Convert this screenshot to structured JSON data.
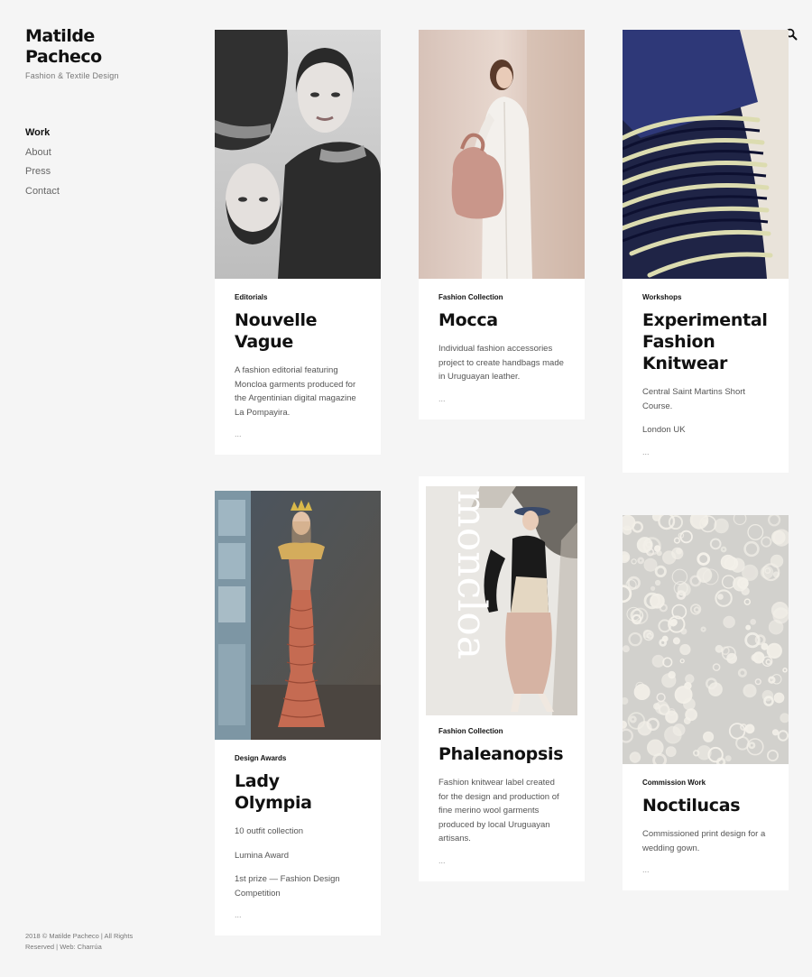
{
  "brand": {
    "name": "Matilde Pacheco",
    "subtitle": "Fashion & Textile Design"
  },
  "nav": {
    "items": [
      {
        "label": "Work",
        "active": true
      },
      {
        "label": "About",
        "active": false
      },
      {
        "label": "Press",
        "active": false
      },
      {
        "label": "Contact",
        "active": false
      }
    ]
  },
  "footer": {
    "text": "2018 © Matilde Pacheco | All Rights Reserved | Web: Charrúa"
  },
  "projects": [
    {
      "category": "Editorials",
      "title": "Nouvelle Vague",
      "paragraphs": [
        "A fashion editorial featuring Moncloa garments produced for the Argentinian digital magazine La Pompayira."
      ],
      "more": "...",
      "image": "editorial-portrait-image"
    },
    {
      "category": "Fashion Collection",
      "title": "Mocca",
      "paragraphs": [
        "Individual fashion accessories project to create handbags made in Uruguayan leather."
      ],
      "more": "...",
      "image": "model-handbag-image"
    },
    {
      "category": "Workshops",
      "title": "Experimental Fashion Knitwear",
      "paragraphs": [
        "Central Saint Martins Short Course.",
        "London UK"
      ],
      "more": "...",
      "image": "knitwear-closeup-image"
    },
    {
      "category": "Design Awards",
      "title": "Lady Olympia",
      "paragraphs": [
        "10 outfit collection",
        "Lumina Award",
        "1st prize — Fashion Design Competition"
      ],
      "more": "...",
      "image": "gown-model-image"
    },
    {
      "category": "Fashion Collection",
      "title": "Phaleanopsis",
      "paragraphs": [
        "Fashion knitwear label created for the design and production of fine merino wool garments produced by local Uruguayan artisans."
      ],
      "more": "...",
      "image": "moncloa-campaign-image",
      "image_text": "moncloa"
    },
    {
      "category": "Commission Work",
      "title": "Noctilucas",
      "paragraphs": [
        "Commissioned print design for a wedding gown."
      ],
      "more": "...",
      "image": "print-pattern-image"
    }
  ]
}
